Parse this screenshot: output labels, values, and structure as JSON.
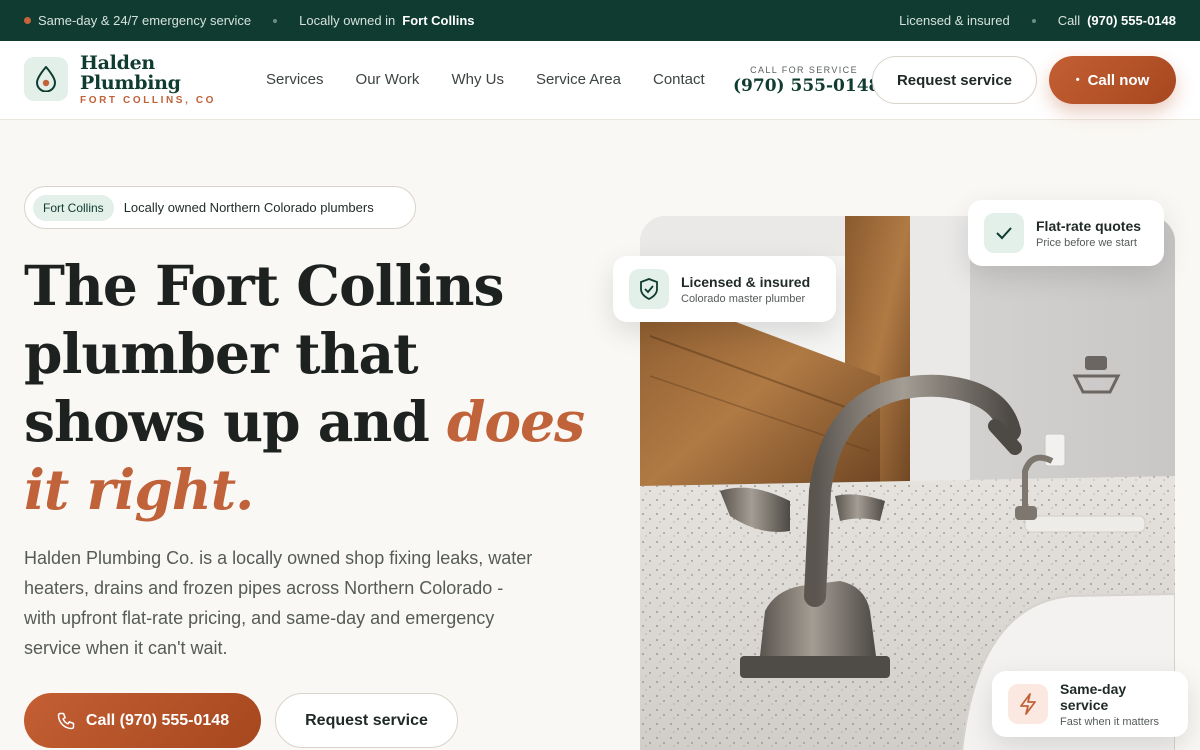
{
  "topbar": {
    "left1": "Same-day & 24/7 emergency service",
    "left2_prefix": "Locally owned in",
    "left2_bold": "Fort Collins",
    "right1": "Licensed & insured",
    "right2_prefix": "Call",
    "right2_bold": "(970) 555-0148"
  },
  "header": {
    "logo_line1": "Halden",
    "logo_line2": "Plumbing",
    "logo_sub": "FORT COLLINS, CO",
    "nav": [
      "Services",
      "Our Work",
      "Why Us",
      "Service Area",
      "Contact"
    ],
    "call_label": "CALL FOR SERVICE",
    "call_number": "(970) 555-0148",
    "request_button": "Request service",
    "call_button": "Call now"
  },
  "hero": {
    "pill_tag": "Fort Collins",
    "pill_text": "Locally owned Northern Colorado plumbers",
    "headline_1": "The Fort Collins",
    "headline_2": "plumber that",
    "headline_3": "shows up and",
    "headline_accent_1": "does",
    "headline_accent_2": "it right.",
    "lede": "Halden Plumbing Co. is a locally owned shop fixing leaks, water heaters, drains and frozen pipes across Northern Colorado - with upfront flat-rate pricing, and same-day and emergency service when it can't wait.",
    "call_button": "Call (970) 555-0148",
    "request_button": "Request service"
  },
  "cards": {
    "licensed": {
      "title": "Licensed & insured",
      "subtitle": "Colorado master plumber",
      "icon": "shield-check-icon"
    },
    "flat_rate": {
      "title": "Flat-rate quotes",
      "subtitle": "Price before we start",
      "icon": "check-icon"
    },
    "same_day": {
      "title": "Same-day service",
      "subtitle": "Fast when it matters",
      "icon": "lightning-icon"
    }
  },
  "colors": {
    "brand_dark": "#0f3b30",
    "accent": "#c0623a",
    "mint": "#e3efe9"
  }
}
